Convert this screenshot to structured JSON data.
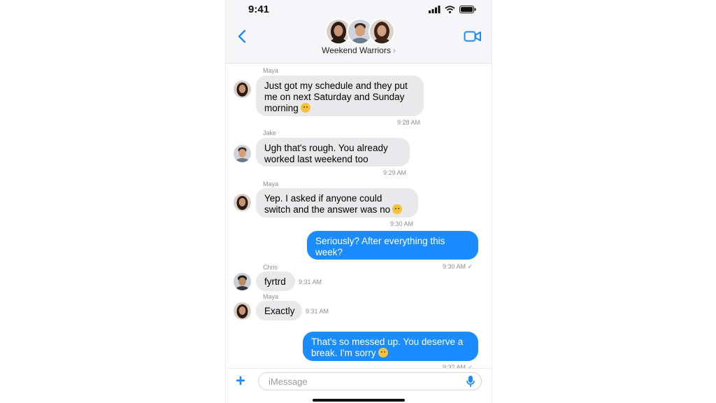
{
  "status_bar": {
    "time": "9:41"
  },
  "header": {
    "group_name": "Weekend Warriors",
    "chevron": "›"
  },
  "icons": {
    "back": "chevron-left-icon",
    "video": "video-camera-icon",
    "signal": "cellular-signal-icon",
    "wifi": "wifi-icon",
    "battery": "battery-icon",
    "plus": "plus-icon",
    "mic": "microphone-icon",
    "read": "checkmark-icon"
  },
  "colors": {
    "accent": "#1a8cff",
    "incoming_bubble": "#e9e9eb",
    "timestamp": "#8e8e93"
  },
  "messages": [
    {
      "sender": "Maya",
      "text": "Just got my schedule and they put me on next Saturday and Sunday morning",
      "time": "9:28 AM",
      "emoji": "weary"
    },
    {
      "sender": "Jake",
      "text": "Ugh that's rough. You already worked last weekend too",
      "time": "9:29 AM"
    },
    {
      "sender": "Maya",
      "text": "Yep. I asked if anyone could switch and the answer was no",
      "time": "9:30 AM",
      "emoji": "unamused"
    },
    {
      "sender": "",
      "text": "Seriously? After everything this week?",
      "time": "9:30 AM ✓"
    },
    {
      "sender": "Chris",
      "text": "fyrtrd",
      "time": "9:31 AM"
    },
    {
      "sender": "Maya",
      "text": "Exactly",
      "time": "9:31 AM"
    },
    {
      "sender": "",
      "text": "That's so messed up. You deserve a break. I'm sorry",
      "time": "9:32 AM ✓",
      "emoji": "sad"
    }
  ],
  "composer": {
    "placeholder": "iMessage",
    "value": ""
  }
}
